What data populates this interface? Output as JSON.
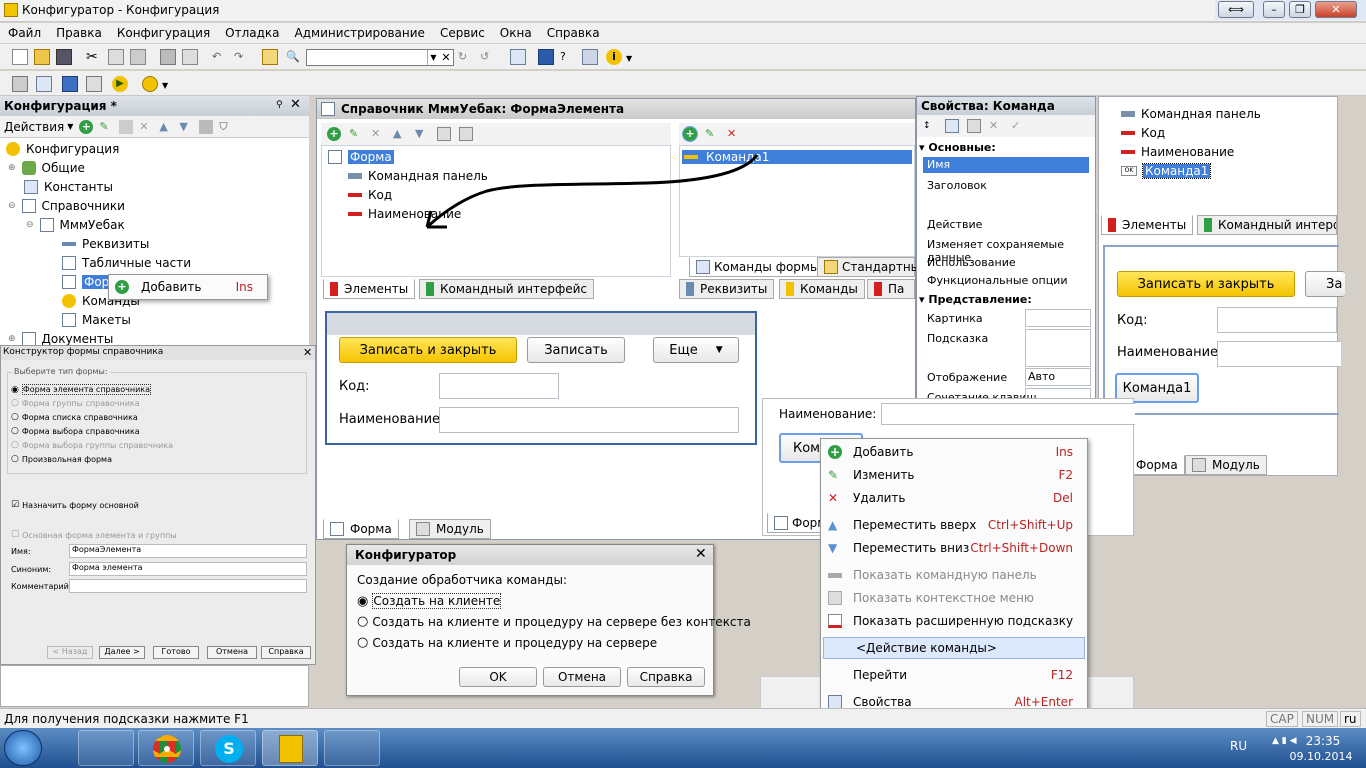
{
  "window": {
    "title": "Конфигуратор - Конфигурация"
  },
  "menu": [
    "Файл",
    "Правка",
    "Конфигурация",
    "Отладка",
    "Администрирование",
    "Сервис",
    "Окна",
    "Справка"
  ],
  "config_panel": {
    "title": "Конфигурация *",
    "actions_label": "Действия",
    "tree": [
      {
        "label": "Конфигурация",
        "icon": "configuration-icon"
      },
      {
        "label": "Общие",
        "icon": "common-icon"
      },
      {
        "label": "Константы",
        "icon": "constants-icon"
      },
      {
        "label": "Справочники",
        "icon": "catalogs-icon"
      },
      {
        "label": "МммУебак",
        "icon": "catalog-icon"
      },
      {
        "label": "Реквизиты",
        "icon": "attribute-icon"
      },
      {
        "label": "Табличные части",
        "icon": "table-icon"
      },
      {
        "label": "Формы",
        "icon": "form-icon"
      },
      {
        "label": "Команды",
        "icon": "command-icon"
      },
      {
        "label": "Макеты",
        "icon": "template-icon"
      },
      {
        "label": "Документы",
        "icon": "document-icon"
      }
    ],
    "add_popup": {
      "label": "Добавить",
      "shortcut": "Ins"
    }
  },
  "wizard": {
    "title": "Конструктор формы справочника",
    "group_label": "Выберите тип формы:",
    "options": [
      "Форма элемента справочника",
      "Форма группы справочника",
      "Форма списка справочника",
      "Форма выбора справочника",
      "Форма выбора группы справочника",
      "Произвольная форма"
    ],
    "checkbox_main": "Назначить форму основной",
    "checkbox_group": "Основная форма элемента и группы",
    "name_label": "Имя:",
    "name_value": "ФормаЭлемента",
    "synonym_label": "Синоним:",
    "synonym_value": "Форма элемента",
    "comment_label": "Комментарий:",
    "buttons": [
      "< Назад",
      "Далее >",
      "Готово",
      "Отмена",
      "Справка"
    ]
  },
  "form_editor": {
    "title": "Справочник МммУебак: ФормаЭлемента",
    "elements": [
      "Форма",
      "Командная панель",
      "Код",
      "Наименование"
    ],
    "commands": [
      "Команда1"
    ],
    "tabs_left": [
      "Элементы",
      "Командный интерфейс"
    ],
    "tabs_right_top": [
      "Команды формы",
      "Стандартные"
    ],
    "tabs_right_bottom": [
      "Реквизиты",
      "Команды",
      "Па"
    ],
    "bottom_tabs": [
      "Форма",
      "Модуль"
    ],
    "preview": {
      "btn_save_close": "Записать и закрыть",
      "btn_save": "Записать",
      "btn_more": "Еще",
      "code_label": "Код:",
      "name_label": "Наименование:"
    }
  },
  "properties": {
    "title": "Свойства: Команда",
    "section_main": "Основные:",
    "rows": [
      "Имя",
      "Заголовок",
      "Действие",
      "Изменяет сохраняемые данные",
      "Использование",
      "Функциональные опции"
    ],
    "section_view": "Представление:",
    "rows2": [
      "Картинка",
      "Подсказка",
      "Отображение",
      "Сочетание клавиш"
    ],
    "display_value": "Авто"
  },
  "right_panel": {
    "items": [
      "Командная панель",
      "Код",
      "Наименование",
      "Команда1"
    ],
    "tabs": [
      "Элементы",
      "Командный интерфейс"
    ],
    "btn_save_close": "Записать и закрыть",
    "btn_partial": "За",
    "code_label": "Код:",
    "name_label": "Наименование:",
    "cmd_button": "Команда1",
    "bottom_tabs": [
      "Форма",
      "Модуль"
    ]
  },
  "mid_fragment": {
    "name_label": "Наименование:",
    "cmd_partial": "Кома",
    "tab": "Форм"
  },
  "dialog": {
    "title": "Конфигуратор",
    "prompt": "Создание обработчика команды:",
    "options": [
      "Создать на клиенте",
      "Создать на клиенте и процедуру на сервере без контекста",
      "Создать на клиенте и процедуру на сервере"
    ],
    "buttons": [
      "OK",
      "Отмена",
      "Справка"
    ]
  },
  "context_menu": [
    {
      "label": "Добавить",
      "shortcut": "Ins",
      "icon": "add-icon",
      "disabled": false
    },
    {
      "label": "Изменить",
      "shortcut": "F2",
      "icon": "edit-icon",
      "disabled": false
    },
    {
      "label": "Удалить",
      "shortcut": "Del",
      "icon": "delete-icon",
      "disabled": false
    },
    {
      "label": "Переместить вверх",
      "shortcut": "Ctrl+Shift+Up",
      "icon": "move-up-icon",
      "disabled": false
    },
    {
      "label": "Переместить вниз",
      "shortcut": "Ctrl+Shift+Down",
      "icon": "move-down-icon",
      "disabled": false
    },
    {
      "label": "Показать командную панель",
      "shortcut": "",
      "icon": "command-panel-icon",
      "disabled": true
    },
    {
      "label": "Показать контекстное меню",
      "shortcut": "",
      "icon": "context-menu-icon",
      "disabled": true
    },
    {
      "label": "Показать расширенную подсказку",
      "shortcut": "",
      "icon": "tooltip-icon",
      "disabled": false
    },
    {
      "label": "<Действие команды>",
      "shortcut": "",
      "icon": "",
      "disabled": false
    },
    {
      "label": "Перейти",
      "shortcut": "F12",
      "icon": "",
      "disabled": false
    },
    {
      "label": "Свойства",
      "shortcut": "Alt+Enter",
      "icon": "properties-icon",
      "disabled": false
    }
  ],
  "status": {
    "hint": "Для получения подсказки нажмите F1",
    "caps": "CAP",
    "num": "NUM",
    "lang": "ru"
  },
  "taskbar": {
    "lang": "RU",
    "time": "23:35",
    "date": "09.10.2014"
  },
  "colors": {
    "accent_blue": "#3f7fd9",
    "yellow_button": "#f5c400",
    "red_delete": "#d21f1f",
    "green_add": "#2f9e44"
  }
}
